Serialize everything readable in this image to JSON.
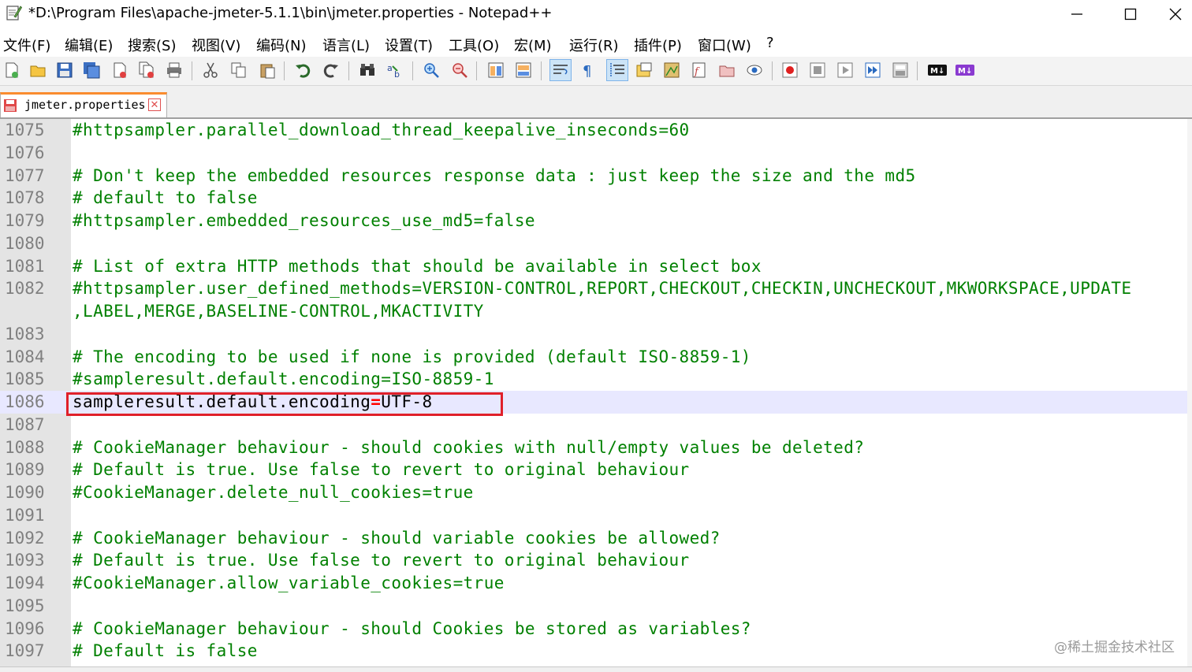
{
  "window": {
    "title": "*D:\\Program Files\\apache-jmeter-5.1.1\\bin\\jmeter.properties - Notepad++",
    "minimize": "—",
    "maximize": "☐",
    "close": "✕"
  },
  "menu": [
    "文件(F)",
    "编辑(E)",
    "搜索(S)",
    "视图(V)",
    "编码(N)",
    "语言(L)",
    "设置(T)",
    "工具(O)",
    "宏(M)",
    "运行(R)",
    "插件(P)",
    "窗口(W)",
    "?"
  ],
  "toolbar_icons": [
    "new-file-icon",
    "open-file-icon",
    "save-icon",
    "save-all-icon",
    "close-icon",
    "close-all-icon",
    "print-icon",
    "cut-icon",
    "copy-icon",
    "paste-icon",
    "undo-icon",
    "redo-icon",
    "find-icon",
    "replace-icon",
    "zoom-in-icon",
    "zoom-out-icon",
    "sync-vertical-icon",
    "sync-horizontal-icon",
    "word-wrap-icon",
    "show-all-chars-icon",
    "indent-guide-icon",
    "udl-icon",
    "doc-map-icon",
    "function-list-icon",
    "folder-workspace-icon",
    "monitoring-icon",
    "macro-record-icon",
    "macro-stop-icon",
    "macro-play-icon",
    "macro-run-multiple-icon",
    "macro-save-icon",
    "markdown-icon",
    "markdown-preview-icon"
  ],
  "tab": {
    "label": "jmeter.properties",
    "close": "✕"
  },
  "lines": [
    {
      "n": "1075",
      "parts": [
        {
          "t": "#httpsampler.parallel_download_thread_keepalive_inseconds=60",
          "c": "comment"
        }
      ]
    },
    {
      "n": "1076",
      "parts": []
    },
    {
      "n": "1077",
      "parts": [
        {
          "t": "# Don't keep the embedded resources response data : just keep the size and the md5",
          "c": "comment"
        }
      ]
    },
    {
      "n": "1078",
      "parts": [
        {
          "t": "# default to false",
          "c": "comment"
        }
      ]
    },
    {
      "n": "1079",
      "parts": [
        {
          "t": "#httpsampler.embedded_resources_use_md5=false",
          "c": "comment"
        }
      ]
    },
    {
      "n": "1080",
      "parts": []
    },
    {
      "n": "1081",
      "parts": [
        {
          "t": "# List of extra HTTP methods that should be available in select box",
          "c": "comment"
        }
      ]
    },
    {
      "n": "1082",
      "parts": [
        {
          "t": "#httpsampler.user_defined_methods=VERSION-CONTROL,REPORT,CHECKOUT,CHECKIN,UNCHECKOUT,MKWORKSPACE,UPDATE",
          "c": "comment"
        }
      ]
    },
    {
      "n": "",
      "parts": [
        {
          "t": ",LABEL,MERGE,BASELINE-CONTROL,MKACTIVITY",
          "c": "comment"
        }
      ]
    },
    {
      "n": "1083",
      "parts": []
    },
    {
      "n": "1084",
      "parts": [
        {
          "t": "# The encoding to be used if none is provided (default ISO-8859-1)",
          "c": "comment"
        }
      ]
    },
    {
      "n": "1085",
      "parts": [
        {
          "t": "#sampleresult.default.encoding=ISO-8859-1",
          "c": "comment"
        }
      ]
    },
    {
      "n": "1086",
      "current": true,
      "parts": [
        {
          "t": "sampleresult.default.encoding",
          "c": "key"
        },
        {
          "t": "=",
          "c": "eq red"
        },
        {
          "t": "UTF-8",
          "c": "key"
        }
      ]
    },
    {
      "n": "1087",
      "parts": []
    },
    {
      "n": "1088",
      "parts": [
        {
          "t": "# CookieManager behaviour - should cookies with null/empty values be deleted?",
          "c": "comment"
        }
      ]
    },
    {
      "n": "1089",
      "parts": [
        {
          "t": "# Default is true. Use false to revert to original behaviour",
          "c": "comment"
        }
      ]
    },
    {
      "n": "1090",
      "parts": [
        {
          "t": "#CookieManager.delete_null_cookies=true",
          "c": "comment"
        }
      ]
    },
    {
      "n": "1091",
      "parts": []
    },
    {
      "n": "1092",
      "parts": [
        {
          "t": "# CookieManager behaviour - should variable cookies be allowed?",
          "c": "comment"
        }
      ]
    },
    {
      "n": "1093",
      "parts": [
        {
          "t": "# Default is true. Use false to revert to original behaviour",
          "c": "comment"
        }
      ]
    },
    {
      "n": "1094",
      "parts": [
        {
          "t": "#CookieManager.allow_variable_cookies=true",
          "c": "comment"
        }
      ]
    },
    {
      "n": "1095",
      "parts": []
    },
    {
      "n": "1096",
      "parts": [
        {
          "t": "# CookieManager behaviour - should Cookies be stored as variables?",
          "c": "comment"
        }
      ]
    },
    {
      "n": "1097",
      "parts": [
        {
          "t": "# Default is false",
          "c": "comment"
        }
      ]
    }
  ],
  "watermark": "@稀土掘金技术社区",
  "colors": {
    "comment": "#008000",
    "gutter": "#e4e4e4",
    "current_line": "#e8e8ff",
    "highlight_box": "#e0202a"
  }
}
